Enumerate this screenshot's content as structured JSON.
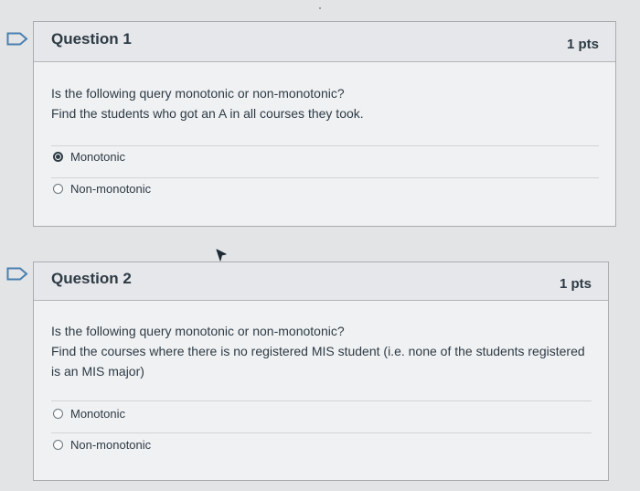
{
  "questions": [
    {
      "title": "Question 1",
      "points": "1 pts",
      "text_lines": [
        "Is the following query monotonic or non-monotonic?",
        "Find the students who got an A in all courses they took."
      ],
      "answers": [
        {
          "label": "Monotonic",
          "selected": true
        },
        {
          "label": "Non-monotonic",
          "selected": false
        }
      ]
    },
    {
      "title": "Question 2",
      "points": "1 pts",
      "text_lines": [
        "Is the following query monotonic or non-monotonic?",
        "Find the courses where there is no registered MIS student (i.e. none of the students registered is an MIS major)"
      ],
      "answers": [
        {
          "label": "Monotonic",
          "selected": false
        },
        {
          "label": "Non-monotonic",
          "selected": false
        }
      ]
    }
  ],
  "colors": {
    "flag_outline": "#4a7fb0",
    "text": "#2d3b45",
    "header_bg": "#e6e7ea",
    "body_bg": "#f0f1f3"
  },
  "icons": {
    "flag": "flag-outline-icon",
    "cursor": "mouse-pointer-icon"
  }
}
